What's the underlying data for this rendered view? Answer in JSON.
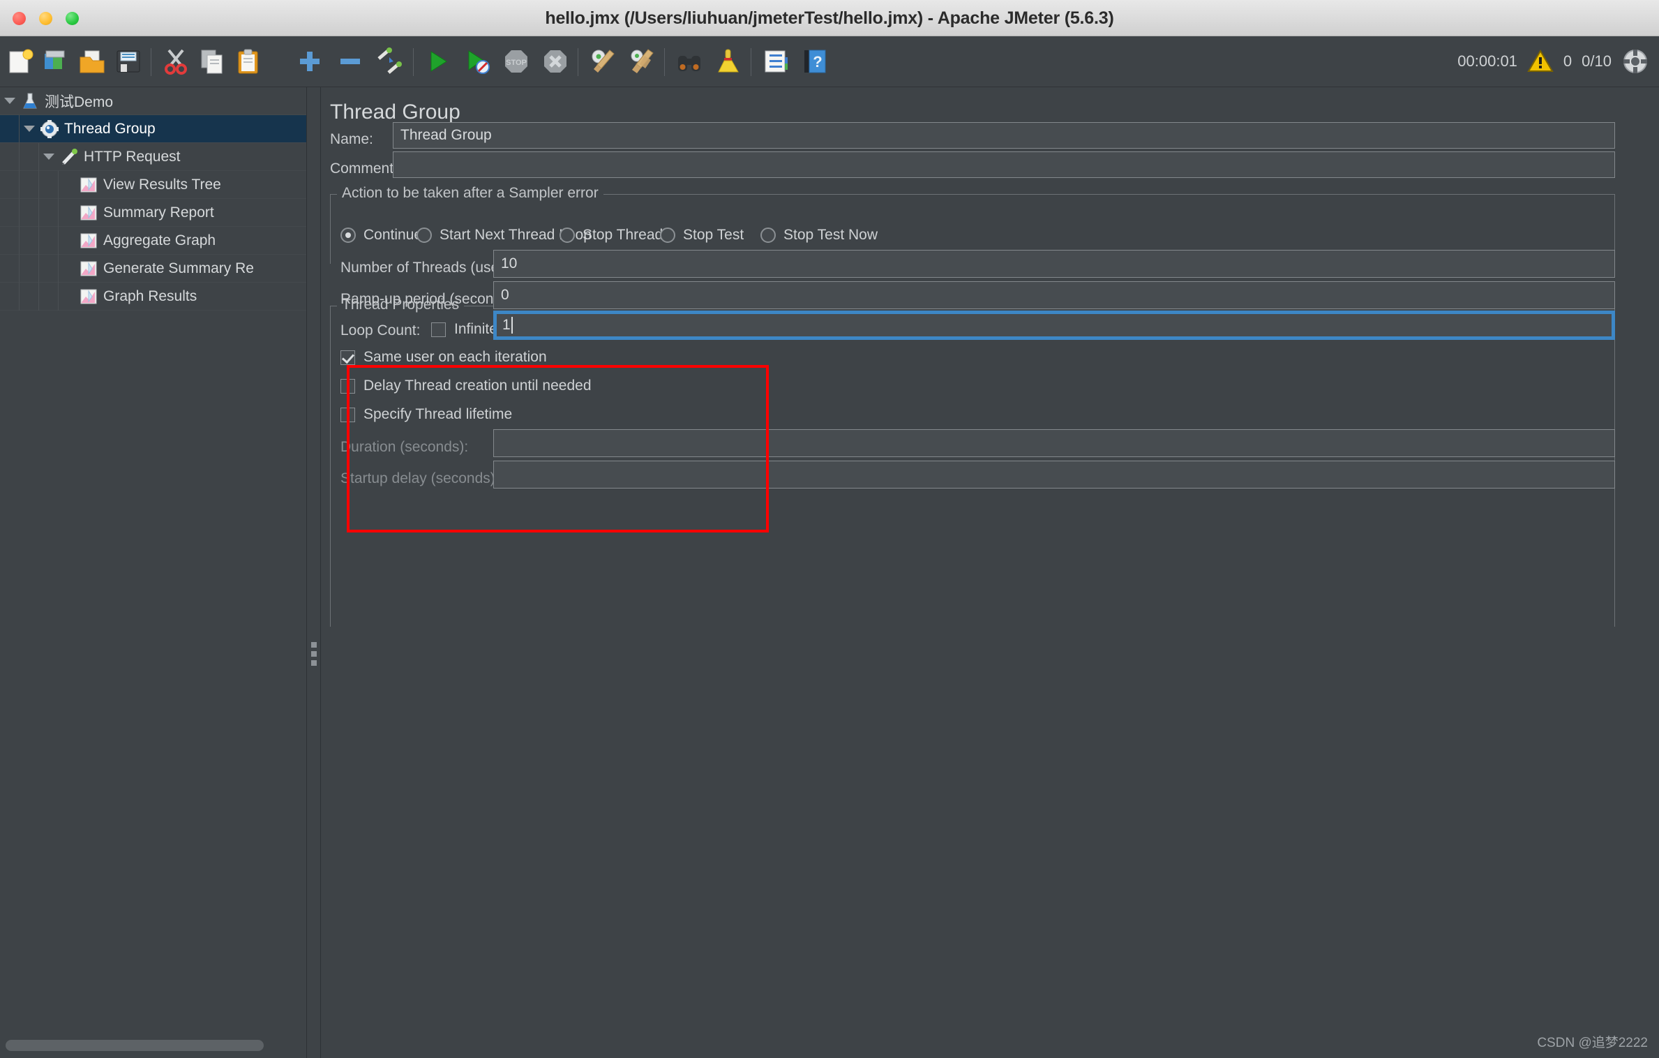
{
  "window": {
    "title": "hello.jmx (/Users/liuhuan/jmeterTest/hello.jmx) - Apache JMeter (5.6.3)"
  },
  "toolbar": {
    "buttons": [
      {
        "name": "new-test-plan",
        "icon": "new-document-icon"
      },
      {
        "name": "templates",
        "icon": "templates-icon"
      },
      {
        "name": "open",
        "icon": "open-folder-icon"
      },
      {
        "name": "save-test-plan",
        "icon": "save-diskette-icon"
      },
      {
        "name": "cut",
        "icon": "scissors-icon"
      },
      {
        "name": "copy",
        "icon": "copy-pages-icon"
      },
      {
        "name": "paste",
        "icon": "clipboard-paste-icon"
      },
      {
        "name": "expand-all",
        "icon": "plus-icon"
      },
      {
        "name": "collapse-all",
        "icon": "minus-icon"
      },
      {
        "name": "toggle",
        "icon": "toggle-pencil-icon"
      },
      {
        "name": "start",
        "icon": "green-play-icon"
      },
      {
        "name": "start-no-timers",
        "icon": "green-play-no-timers-icon"
      },
      {
        "name": "stop",
        "icon": "stop-sign-icon"
      },
      {
        "name": "shutdown",
        "icon": "shutdown-x-icon"
      },
      {
        "name": "clear",
        "icon": "gear-broom-icon"
      },
      {
        "name": "clear-all",
        "icon": "gears-broom-icon"
      },
      {
        "name": "search",
        "icon": "binoculars-icon"
      },
      {
        "name": "reset-search",
        "icon": "yellow-broom-icon"
      },
      {
        "name": "function-helper",
        "icon": "notepad-list-icon"
      },
      {
        "name": "help",
        "icon": "blue-help-book-icon"
      }
    ],
    "status": {
      "timer": "00:00:01",
      "warning_icon": "warning-triangle-icon",
      "error_count": "0",
      "thread_count": "0/10",
      "remote_icon": "remote-engines-icon"
    }
  },
  "tree": {
    "nodes": [
      {
        "label": "测试Demo",
        "depth": 0,
        "icon": "test-plan-flask-icon",
        "expandable": true,
        "selected": false
      },
      {
        "label": "Thread Group",
        "depth": 1,
        "icon": "thread-group-gear-icon",
        "expandable": true,
        "selected": true
      },
      {
        "label": "HTTP Request",
        "depth": 2,
        "icon": "http-request-pen-icon",
        "expandable": true,
        "selected": false
      },
      {
        "label": "View Results Tree",
        "depth": 3,
        "icon": "listener-chart-icon",
        "expandable": false,
        "selected": false
      },
      {
        "label": "Summary Report",
        "depth": 3,
        "icon": "listener-chart-icon",
        "expandable": false,
        "selected": false
      },
      {
        "label": "Aggregate Graph",
        "depth": 3,
        "icon": "listener-chart-icon",
        "expandable": false,
        "selected": false
      },
      {
        "label": "Generate Summary Re",
        "depth": 3,
        "icon": "listener-chart-icon",
        "expandable": false,
        "selected": false
      },
      {
        "label": "Graph Results",
        "depth": 3,
        "icon": "listener-chart-icon",
        "expandable": false,
        "selected": false
      }
    ]
  },
  "main": {
    "page_title": "Thread Group",
    "name_label": "Name:",
    "name_value": "Thread Group",
    "comments_label": "Comments:",
    "comments_value": "",
    "sampler_error": {
      "legend": "Action to be taken after a Sampler error",
      "options": [
        {
          "label": "Continue",
          "selected": true
        },
        {
          "label": "Start Next Thread Loop",
          "selected": false
        },
        {
          "label": "Stop Thread",
          "selected": false
        },
        {
          "label": "Stop Test",
          "selected": false
        },
        {
          "label": "Stop Test Now",
          "selected": false
        }
      ]
    },
    "thread_properties": {
      "legend": "Thread Properties",
      "threads_label": "Number of Threads (users):",
      "threads_value": "10",
      "rampup_label": "Ramp-up period (seconds):",
      "rampup_value": "0",
      "loop_label": "Loop Count:",
      "infinite_label": "Infinite",
      "infinite_checked": false,
      "loop_value": "1",
      "loop_focused": true,
      "checkboxes": [
        {
          "label": "Same user on each iteration",
          "checked": true
        },
        {
          "label": "Delay Thread creation until needed",
          "checked": false
        },
        {
          "label": "Specify Thread lifetime",
          "checked": false
        }
      ],
      "duration_label": "Duration (seconds):",
      "duration_value": "",
      "startup_label": "Startup delay (seconds):",
      "startup_value": ""
    }
  },
  "annotation": {
    "color": "#ff0000"
  },
  "watermark": "CSDN @追梦2222"
}
